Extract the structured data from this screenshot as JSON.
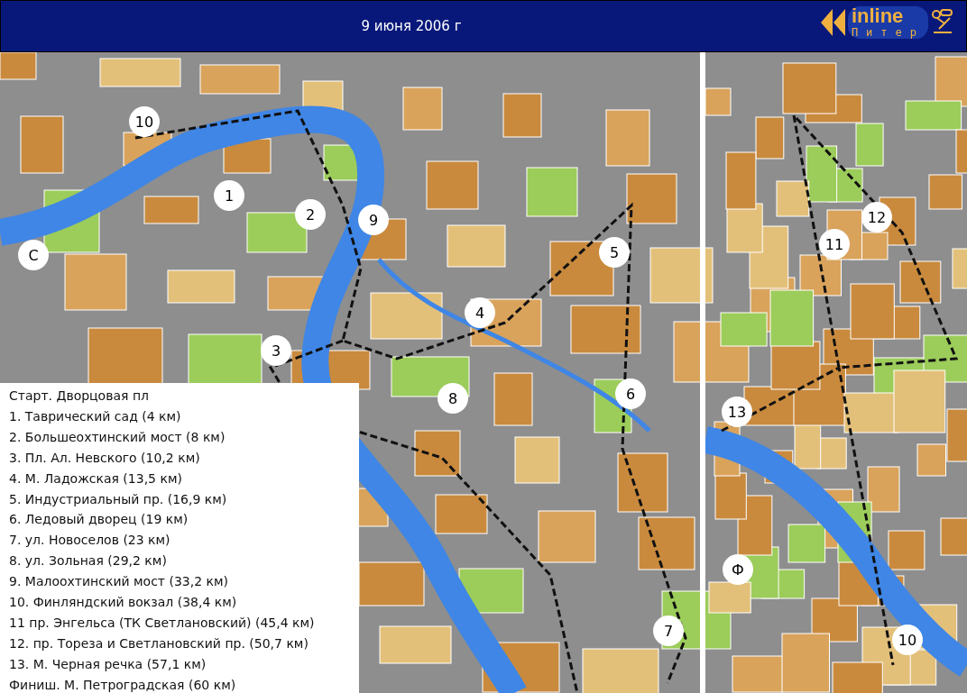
{
  "header": {
    "title": "9 июня 2006 г",
    "logo": {
      "word": "inline",
      "city": "Питер"
    }
  },
  "map": {
    "markers": [
      {
        "label": "1"
      },
      {
        "label": "2"
      },
      {
        "label": "9"
      },
      {
        "label": "10"
      },
      {
        "label": "С"
      },
      {
        "label": "3"
      },
      {
        "label": "4"
      },
      {
        "label": "5"
      },
      {
        "label": "8"
      },
      {
        "label": "6"
      },
      {
        "label": "7"
      },
      {
        "label": "12"
      },
      {
        "label": "11"
      },
      {
        "label": "13"
      },
      {
        "label": "Ф"
      },
      {
        "label": "10"
      }
    ]
  },
  "legend": [
    "Старт. Дворцовая пл",
    "1. Таврический сад (4 км)",
    "2. Большеохтинский мост (8 км)",
    "3. Пл. Ал. Невского (10,2 км)",
    "4. М. Ладожская (13,5 км)",
    "5. Индустриальный пр. (16,9 км)",
    "6. Ледовый дворец (19 км)",
    "7. ул. Новоселов (23 км)",
    "8. ул. Зольная (29,2 км)",
    "9. Малоохтинский мост (33,2 км)",
    "10. Финляндский вокзал (38,4 км)",
    "11 пр. Энгельса (ТК Светлановский) (45,4 км)",
    "12. пр. Тореза и Светлановский пр. (50,7 км)",
    "13. М. Черная речка (57,1 км)",
    "Финиш. М. Петроградская (60 км)"
  ]
}
